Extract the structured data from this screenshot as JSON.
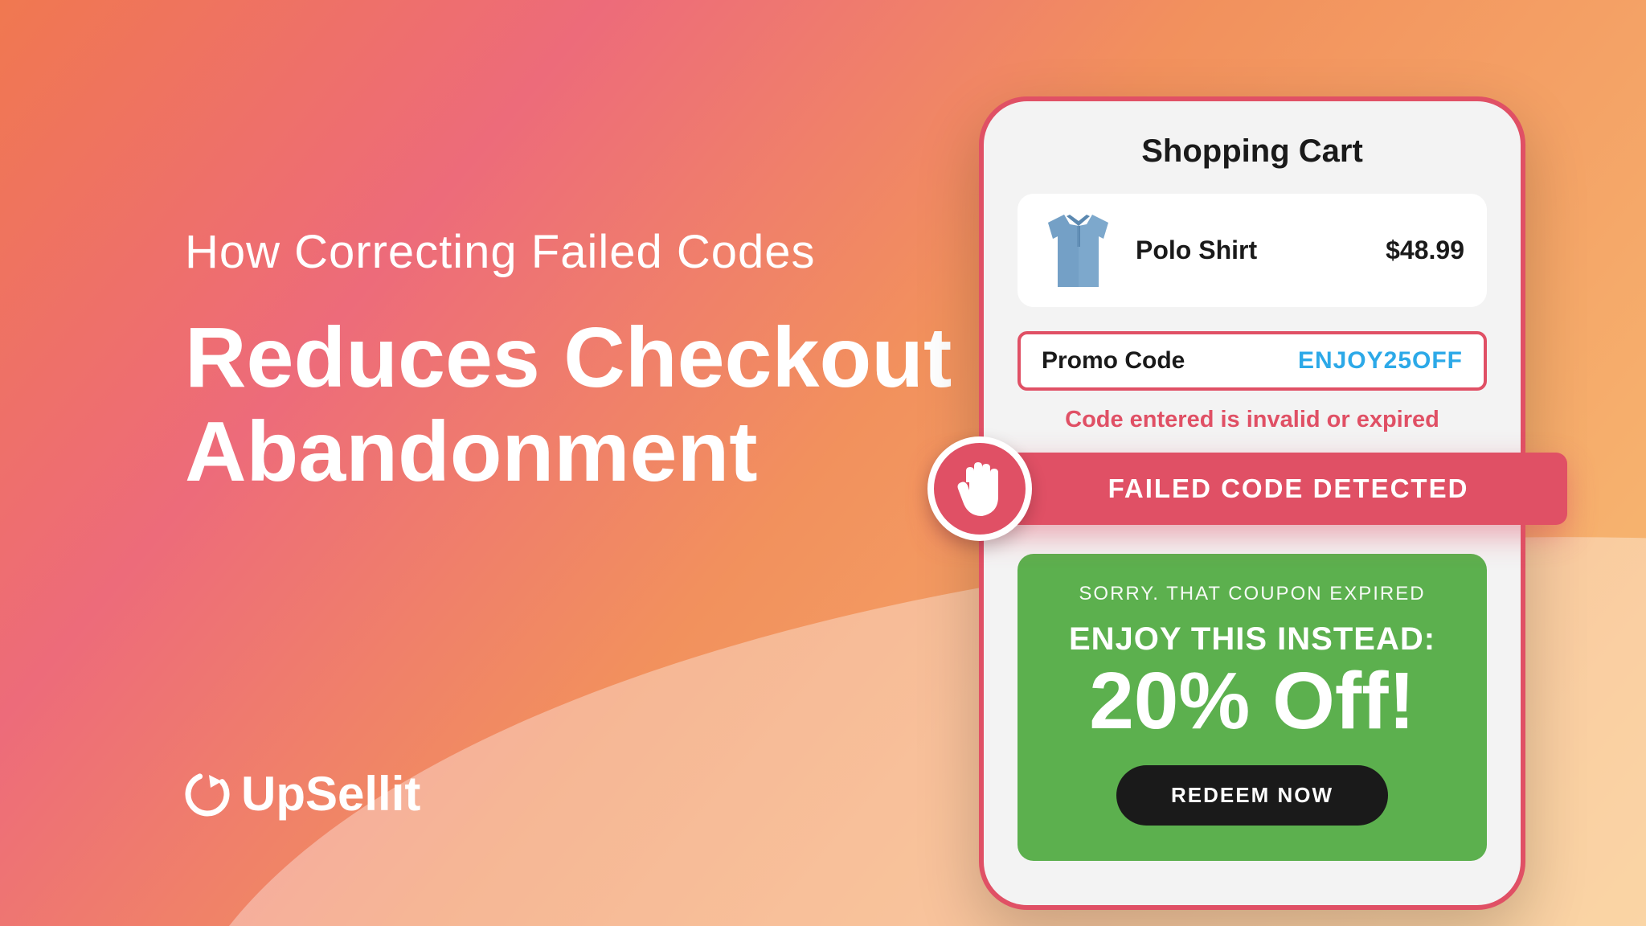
{
  "headline": {
    "subhead": "How Correcting Failed Codes",
    "main_line1": "Reduces Checkout",
    "main_line2": "Abandonment"
  },
  "logo": {
    "text": "UpSellit"
  },
  "cart": {
    "title": "Shopping Cart",
    "item": {
      "name": "Polo Shirt",
      "price": "$48.99"
    },
    "promo": {
      "label": "Promo Code",
      "code": "ENJOY25OFF",
      "error": "Code entered is invalid or expired"
    },
    "banner": "FAILED CODE DETECTED",
    "offer": {
      "sorry": "SORRY. THAT COUPON EXPIRED",
      "enjoy": "ENJOY THIS INSTEAD:",
      "amount": "20% Off!",
      "button": "REDEEM NOW"
    }
  },
  "colors": {
    "accent_red": "#e05065",
    "accent_green": "#5cb04e",
    "code_blue": "#2ca9e8"
  }
}
